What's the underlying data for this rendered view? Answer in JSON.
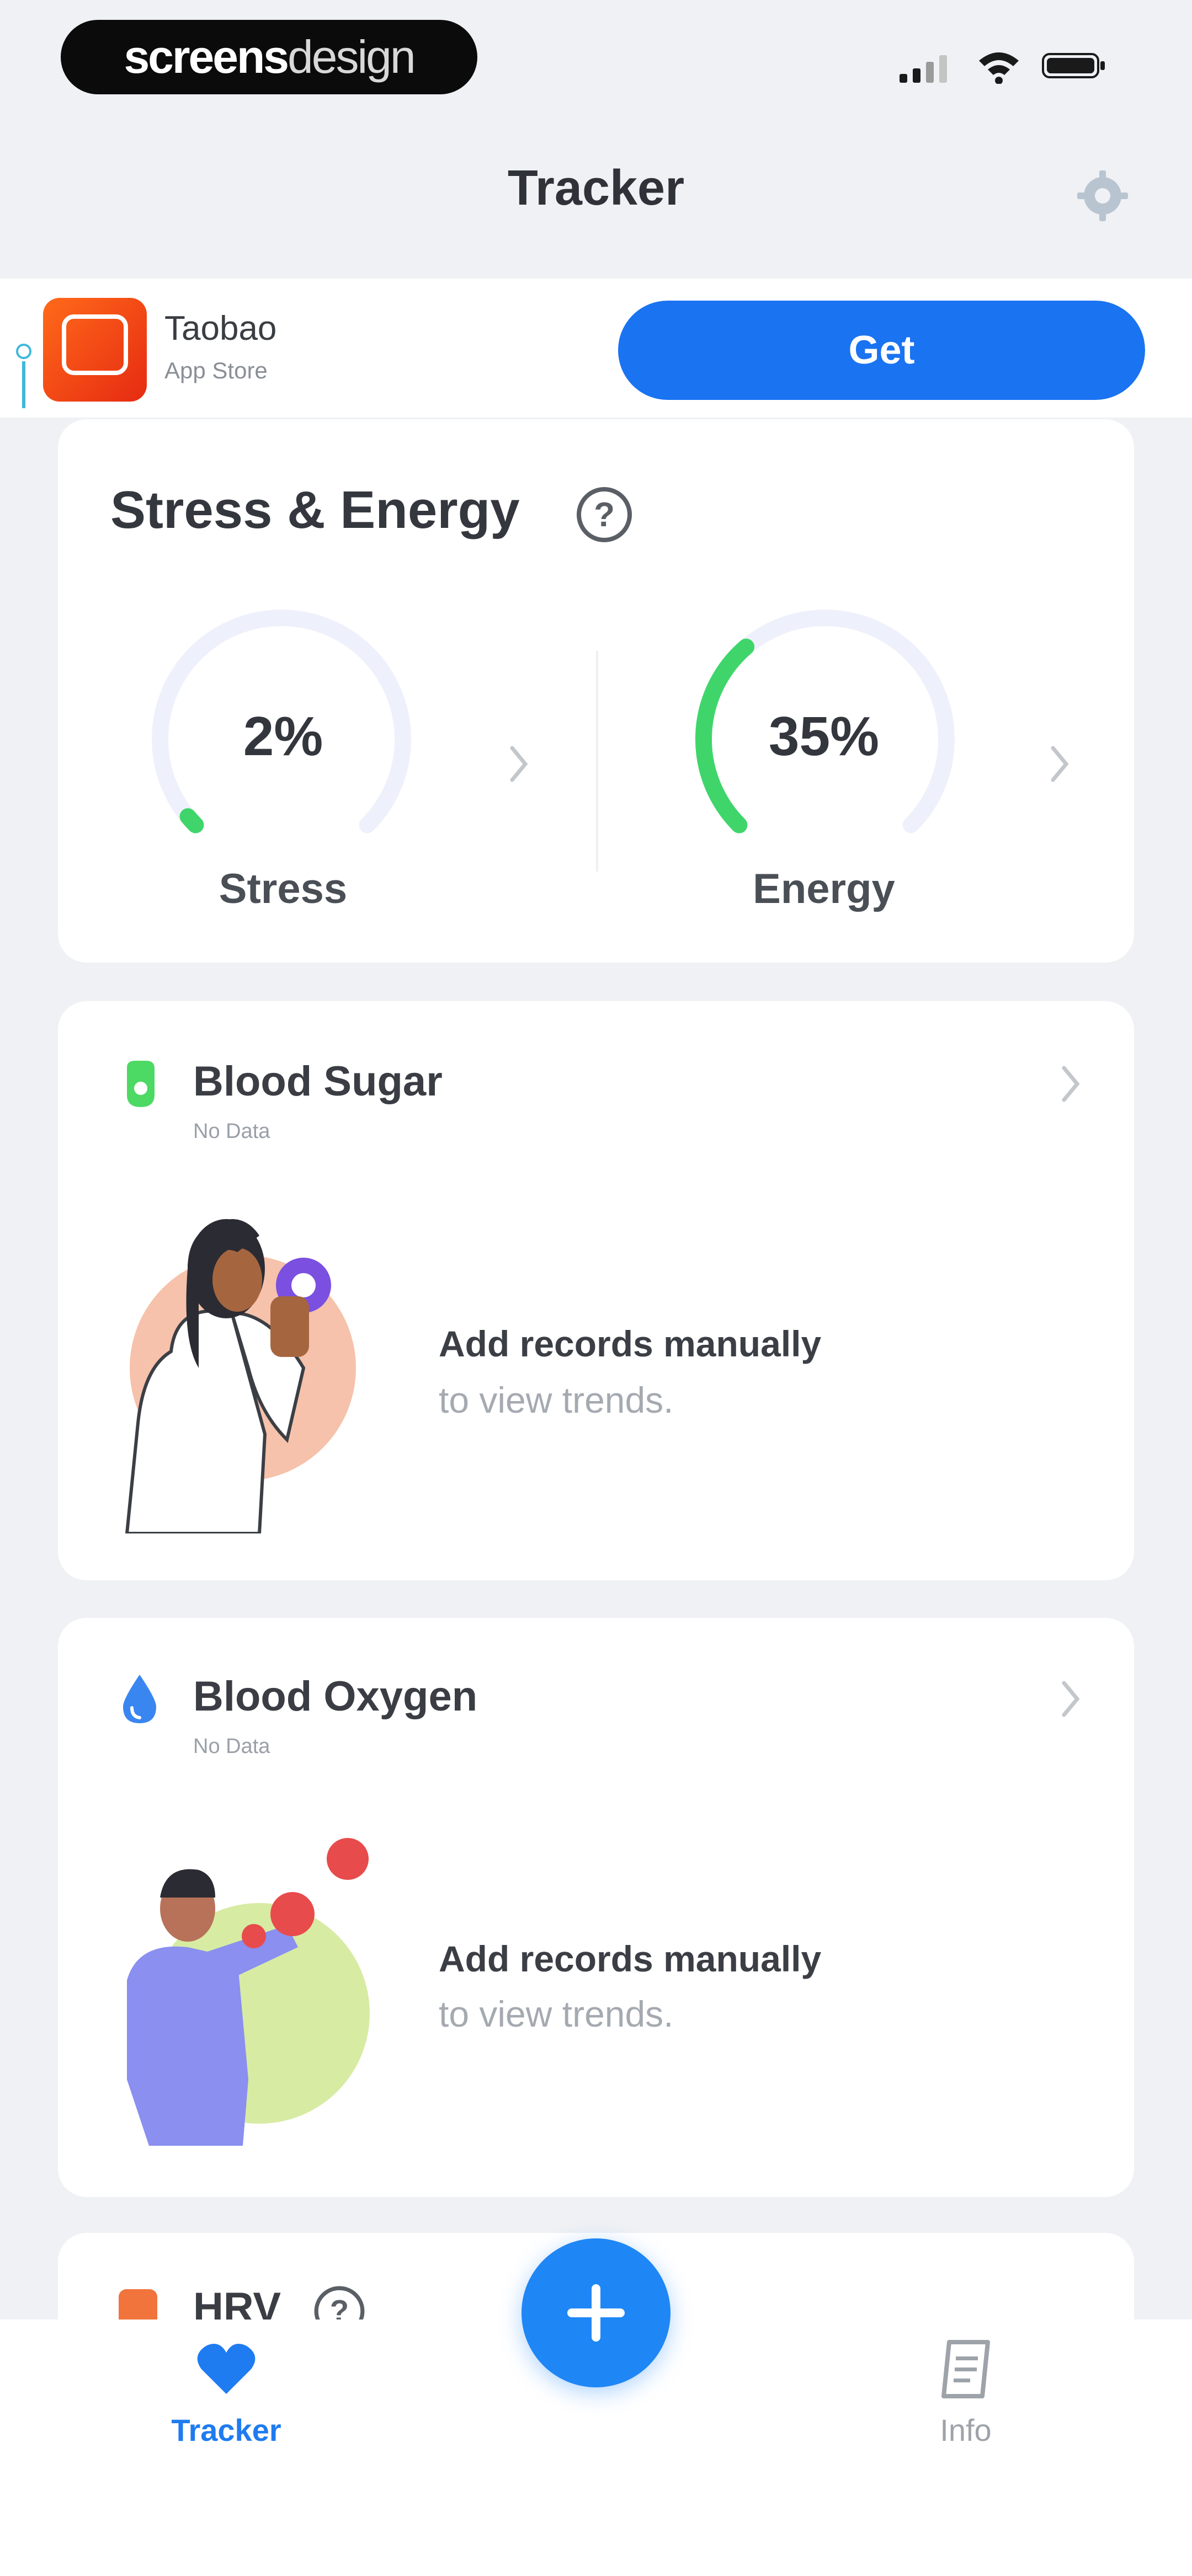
{
  "status_bar": {
    "watermark_bold": "screens",
    "watermark_light": "design"
  },
  "header": {
    "title": "Tracker"
  },
  "ad": {
    "app_name": "Taobao",
    "store": "App Store",
    "button": "Get"
  },
  "stress_energy": {
    "title": "Stress & Energy",
    "stress": {
      "value": "2%",
      "label": "Stress",
      "fraction": 0.02,
      "color": "#3fd56b"
    },
    "energy": {
      "value": "35%",
      "label": "Energy",
      "fraction": 0.35,
      "color": "#3fd56b"
    }
  },
  "blood_sugar": {
    "title": "Blood Sugar",
    "status": "No Data",
    "msg_line1": "Add records manually",
    "msg_line2": "to view trends.",
    "icon_color": "#4cd964"
  },
  "blood_oxygen": {
    "title": "Blood Oxygen",
    "status": "No Data",
    "msg_line1": "Add records manually",
    "msg_line2": "to view trends.",
    "icon_color": "#3a86f0"
  },
  "hrv": {
    "title": "HRV"
  },
  "tabs": [
    {
      "label": "Tracker",
      "icon": "heart-icon",
      "active": true
    },
    {
      "label": "Info",
      "icon": "info-document-icon",
      "active": false
    }
  ],
  "colors": {
    "accent": "#1f7bf0",
    "background": "#eff1f4",
    "gauge_track": "#eef1fb"
  }
}
